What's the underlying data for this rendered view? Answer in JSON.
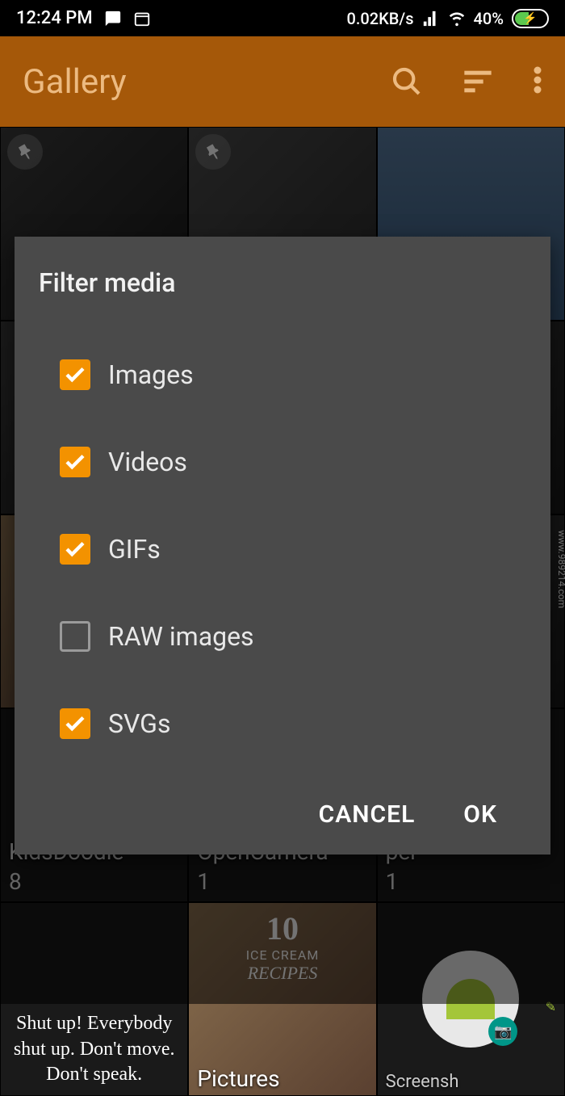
{
  "status": {
    "time": "12:24 PM",
    "data_rate": "0.02KB/s",
    "battery_pct": "40%"
  },
  "appbar": {
    "title": "Gallery"
  },
  "dialog": {
    "title": "Filter media",
    "options": [
      {
        "label": "Images",
        "checked": true
      },
      {
        "label": "Videos",
        "checked": true
      },
      {
        "label": "GIFs",
        "checked": true
      },
      {
        "label": "RAW images",
        "checked": false
      },
      {
        "label": "SVGs",
        "checked": true
      }
    ],
    "cancel": "CANCEL",
    "ok": "OK"
  },
  "albums": [
    {
      "name": "KidsDoodle",
      "count": "8"
    },
    {
      "name": "OpenCamera",
      "count": "1"
    },
    {
      "name": "per",
      "count": "1"
    },
    {
      "name_sub": "Pictures"
    },
    {
      "name_sub": "Screensh"
    }
  ],
  "tile_text": {
    "quote": "Shut up! Everybody shut up. Don't move. Don't speak.",
    "recipes_top": "10",
    "recipes_sub": "ICE CREAM",
    "recipes_word": "RECIPES"
  },
  "watermark": "www.989214.com"
}
